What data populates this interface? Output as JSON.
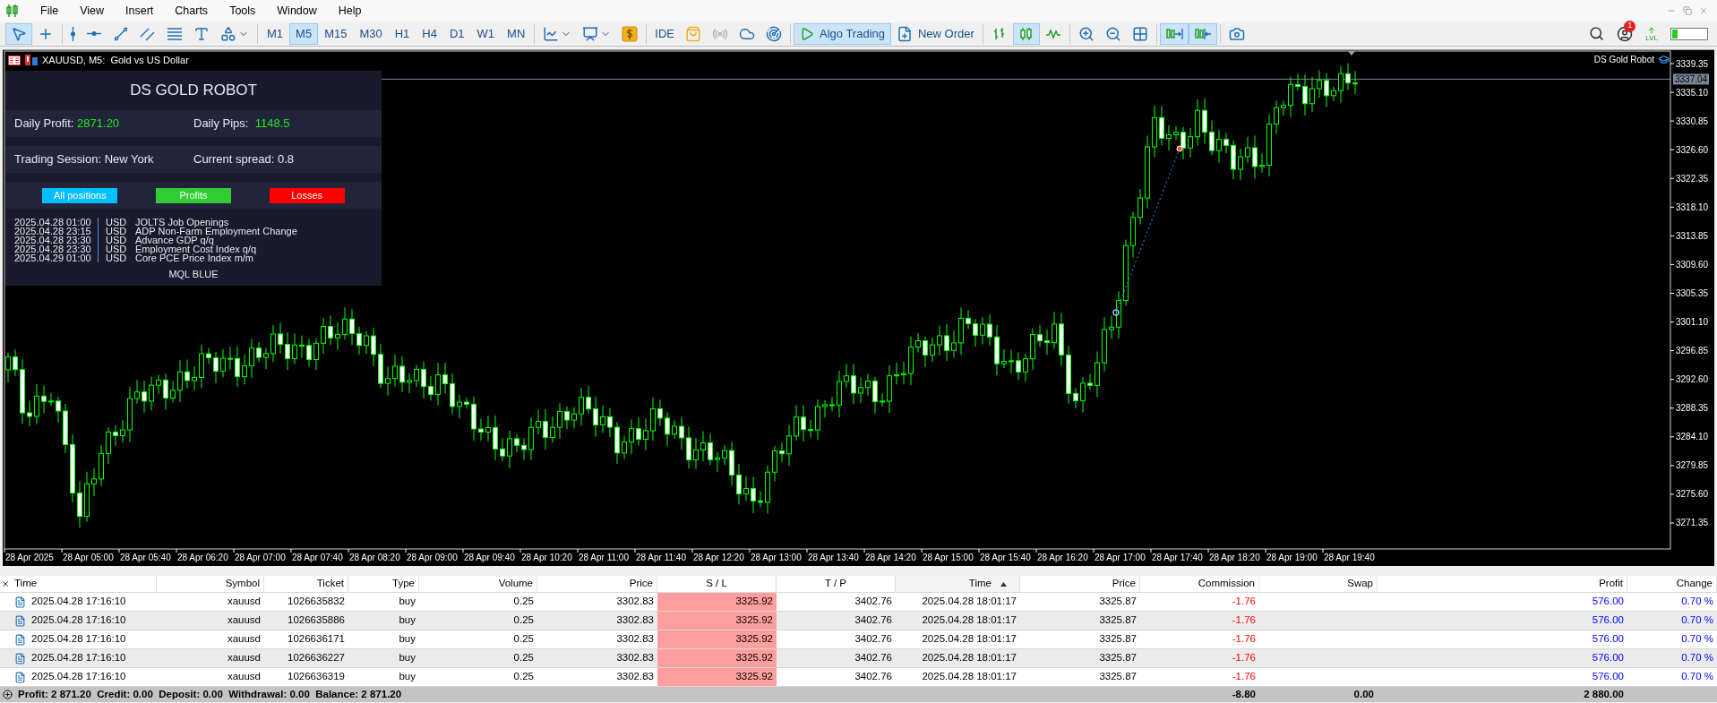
{
  "menu": [
    "File",
    "View",
    "Insert",
    "Charts",
    "Tools",
    "Window",
    "Help"
  ],
  "toolbar": {
    "cursor_selected": true,
    "timeframes": [
      {
        "label": "M1",
        "selected": false
      },
      {
        "label": "M5",
        "selected": true
      },
      {
        "label": "M15",
        "selected": false
      },
      {
        "label": "M30",
        "selected": false
      },
      {
        "label": "H1",
        "selected": false
      },
      {
        "label": "H4",
        "selected": false
      },
      {
        "label": "D1",
        "selected": false
      },
      {
        "label": "W1",
        "selected": false
      },
      {
        "label": "MN",
        "selected": false
      }
    ],
    "ide_label": "IDE",
    "algo_trading": {
      "label": "Algo Trading",
      "on": true
    },
    "new_order_label": "New Order",
    "chart_types": [
      {
        "selected": false
      },
      {
        "selected": true
      },
      {
        "selected": false
      }
    ],
    "autoscroll_on": true,
    "chart_shift_on": true,
    "notification_count": "1",
    "level_label": "LVL"
  },
  "chart": {
    "title": "XAUUSD, M5:  Gold vs US Dollar",
    "expert": "DS Gold Robot",
    "current_price": "3337.04",
    "price_ticks": [
      "3339.35",
      "3335.10",
      "3330.85",
      "3326.60",
      "3322.35",
      "3318.10",
      "3313.85",
      "3309.60",
      "3305.35",
      "3301.10",
      "3296.85",
      "3292.60",
      "3288.35",
      "3284.10",
      "3279.85",
      "3275.60",
      "3271.35"
    ],
    "time_labels": [
      "28 Apr 2025",
      "28 Apr 05:00",
      "28 Apr 05:40",
      "28 Apr 06:20",
      "28 Apr 07:00",
      "28 Apr 07:40",
      "28 Apr 08:20",
      "28 Apr 09:00",
      "28 Apr 09:40",
      "28 Apr 10:20",
      "28 Apr 11:00",
      "28 Apr 11:40",
      "28 Apr 12:20",
      "28 Apr 13:00",
      "28 Apr 13:40",
      "28 Apr 14:20",
      "28 Apr 15:00",
      "28 Apr 15:40",
      "28 Apr 16:20",
      "28 Apr 17:00",
      "28 Apr 17:40",
      "28 Apr 18:20",
      "28 Apr 19:00",
      "28 Apr 19:40"
    ]
  },
  "panel": {
    "title": "DS GOLD ROBOT",
    "daily_profit": {
      "label": "Daily Profit:",
      "value": "2871.20"
    },
    "daily_pips": {
      "label": "Daily Pips:",
      "value": "1148.5"
    },
    "trading_session": "Trading Session: New York",
    "current_spread": "Current spread: 0.8",
    "buttons": [
      {
        "label": "All positions",
        "color": "#00bfff"
      },
      {
        "label": "Profits",
        "color": "#32cd32"
      },
      {
        "label": "Losses",
        "color": "#ff0000"
      }
    ],
    "news": [
      {
        "time": "2025.04.28 01:00",
        "currency": "USD",
        "event": "JOLTS Job Openings"
      },
      {
        "time": "2025.04.28 23:15",
        "currency": "USD",
        "event": "ADP Non-Farm Employment Change"
      },
      {
        "time": "2025.04.28 23:30",
        "currency": "USD",
        "event": "Advance GDP q/q"
      },
      {
        "time": "2025.04.28 23:30",
        "currency": "USD",
        "event": "Employment Cost Index q/q"
      },
      {
        "time": "2025.04.29 01:00",
        "currency": "USD",
        "event": "Core PCE Price Index m/m"
      }
    ],
    "footer": "MQL BLUE"
  },
  "table": {
    "columns": [
      {
        "label": "Time",
        "sorted": false
      },
      {
        "label": "Symbol",
        "sorted": false
      },
      {
        "label": "Ticket",
        "sorted": false
      },
      {
        "label": "Type",
        "sorted": false
      },
      {
        "label": "Volume",
        "sorted": false
      },
      {
        "label": "Price",
        "sorted": false
      },
      {
        "label": "S / L",
        "sorted": false
      },
      {
        "label": "T / P",
        "sorted": false
      },
      {
        "label": "Time",
        "sorted": true
      },
      {
        "label": "Price",
        "sorted": false
      },
      {
        "label": "Commission",
        "sorted": false
      },
      {
        "label": "Swap",
        "sorted": false
      },
      {
        "label": "Profit",
        "sorted": false
      },
      {
        "label": "Change",
        "sorted": false
      }
    ],
    "rows": [
      {
        "cells": [
          "2025.04.28 17:16:10",
          "xauusd",
          "1026635832",
          "buy",
          "0.25",
          "3302.83",
          "3325.92",
          "3402.76",
          "2025.04.28 18:01:17",
          "3325.87",
          "-1.76",
          "",
          "576.00",
          "0.70 %"
        ]
      },
      {
        "cells": [
          "2025.04.28 17:16:10",
          "xauusd",
          "1026635886",
          "buy",
          "0.25",
          "3302.83",
          "3325.92",
          "3402.76",
          "2025.04.28 18:01:17",
          "3325.87",
          "-1.76",
          "",
          "576.00",
          "0.70 %"
        ]
      },
      {
        "cells": [
          "2025.04.28 17:16:10",
          "xauusd",
          "1026636171",
          "buy",
          "0.25",
          "3302.83",
          "3325.92",
          "3402.76",
          "2025.04.28 18:01:17",
          "3325.87",
          "-1.76",
          "",
          "576.00",
          "0.70 %"
        ]
      },
      {
        "cells": [
          "2025.04.28 17:16:10",
          "xauusd",
          "1026636227",
          "buy",
          "0.25",
          "3302.83",
          "3325.92",
          "3402.76",
          "2025.04.28 18:01:17",
          "3325.87",
          "-1.76",
          "",
          "576.00",
          "0.70 %"
        ]
      },
      {
        "cells": [
          "2025.04.28 17:16:10",
          "xauusd",
          "1026636319",
          "buy",
          "0.25",
          "3302.83",
          "3325.92",
          "3402.76",
          "2025.04.28 18:01:17",
          "3325.87",
          "-1.76",
          "",
          "576.00",
          "0.70 %"
        ]
      }
    ],
    "footer": {
      "summary": "Profit: 2 871.20  Credit: 0.00  Deposit: 0.00  Withdrawal: 0.00  Balance: 2 871.20",
      "commission": "-8.80",
      "swap": "0.00",
      "profit": "2 880.00"
    }
  }
}
